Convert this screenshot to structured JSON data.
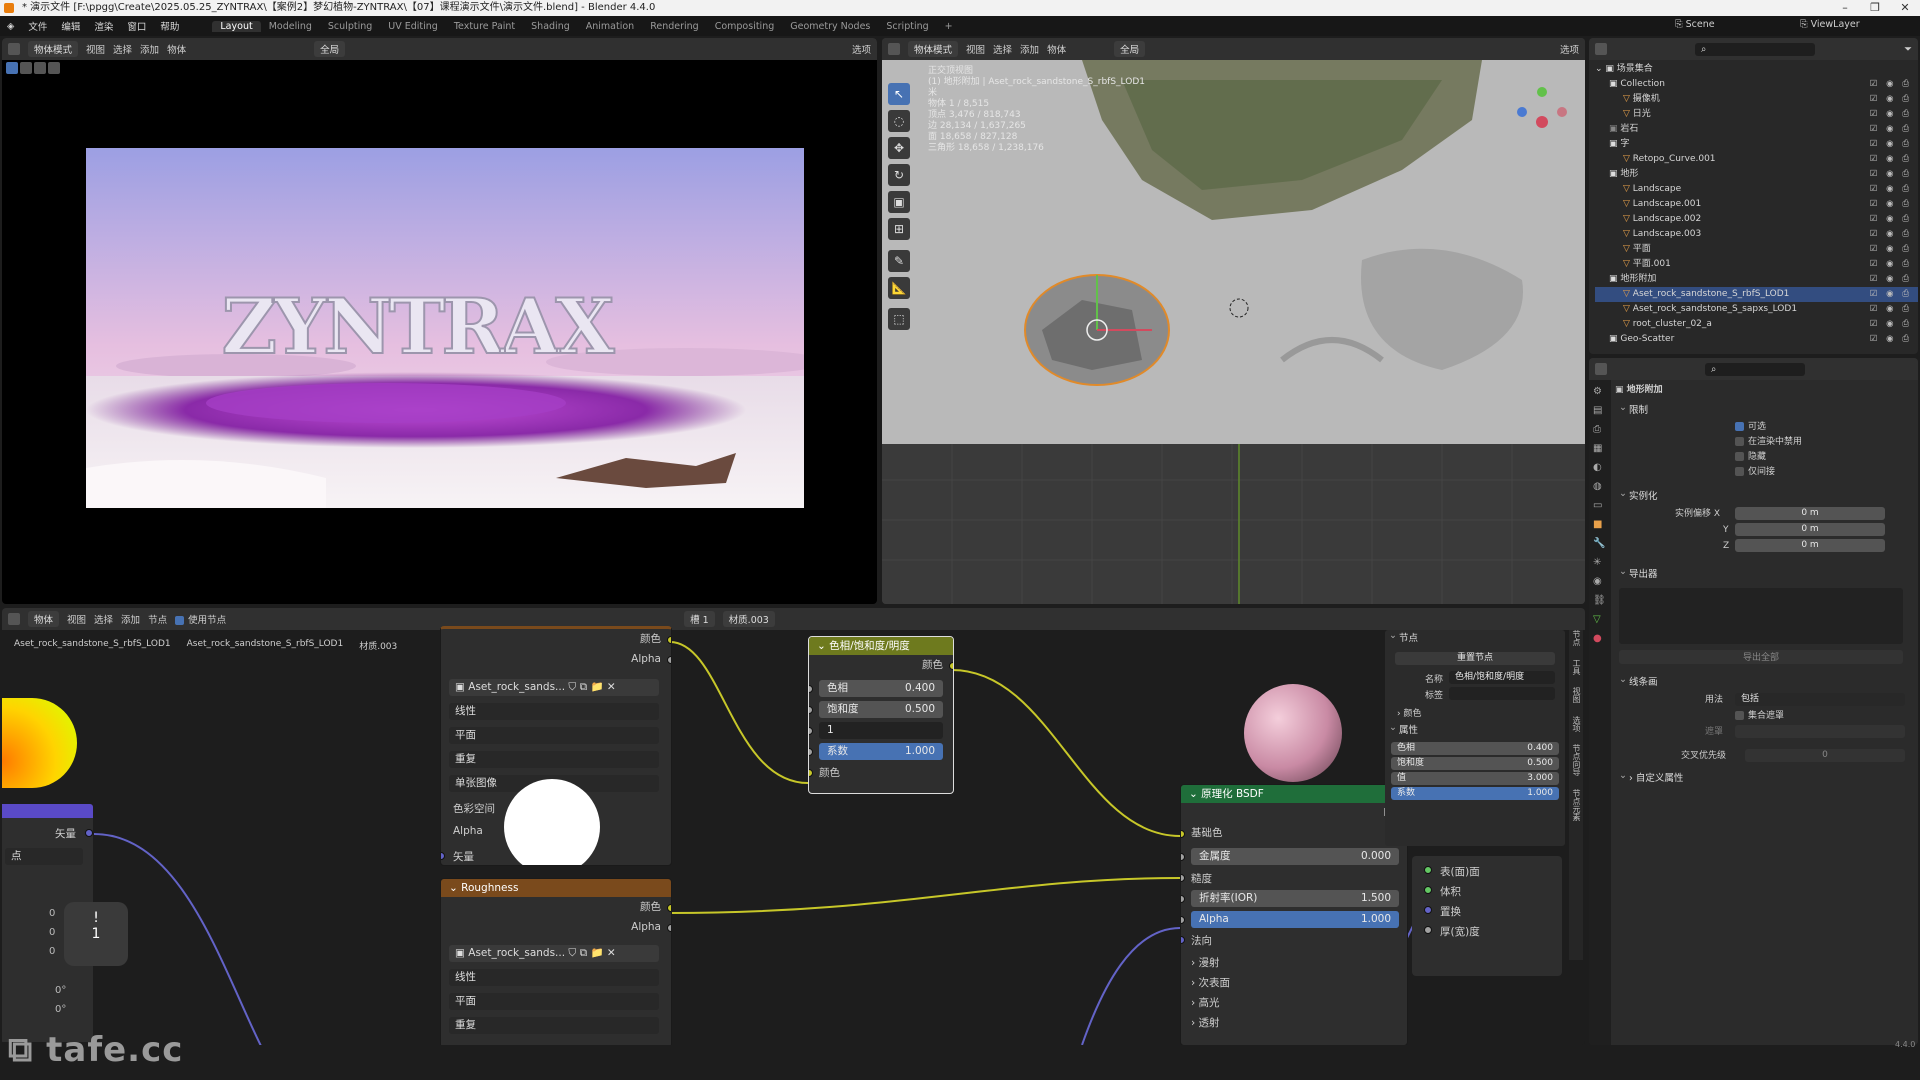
{
  "window": {
    "title": "* 演示文件 [F:\\ppgg\\Create\\2025.05.25_ZYNTRAX\\【案例2】梦幻植物-ZYNTRAX\\【07】课程演示文件\\演示文件.blend] - Blender 4.4.0",
    "min": "–",
    "max": "❐",
    "close": "✕"
  },
  "menu": [
    "文件",
    "编辑",
    "渲染",
    "窗口",
    "帮助"
  ],
  "workspaces": [
    "Layout",
    "Modeling",
    "Sculpting",
    "UV Editing",
    "Texture Paint",
    "Shading",
    "Animation",
    "Rendering",
    "Compositing",
    "Geometry Nodes",
    "Scripting",
    "+"
  ],
  "top_right": {
    "scene": "Scene",
    "viewlayer": "ViewLayer"
  },
  "left_view": {
    "mode": "物体模式",
    "menus": [
      "视图",
      "选择",
      "添加",
      "物体"
    ],
    "global": "全局",
    "options": "选项",
    "logo_text": "ZYNTRAX"
  },
  "view3d": {
    "mode": "物体模式",
    "menus": [
      "视图",
      "选择",
      "添加",
      "物体"
    ],
    "global": "全局",
    "options": "选项",
    "overlay": [
      "正交顶视图",
      "(1) 地形附加 | Aset_rock_sandstone_S_rbfS_LOD1",
      "米",
      "物体   1 / 8,515",
      "顶点   3,476 / 818,743",
      "边   28,134 / 1,637,265",
      "面   18,658 / 827,128",
      "三角形   18,658 / 1,238,176"
    ],
    "tools": [
      "↖",
      "◌",
      "✥",
      "↻",
      "▣",
      "⊞",
      "✎",
      "📐",
      "⬚"
    ]
  },
  "node_editor": {
    "header": {
      "mode": "物体",
      "menus": [
        "视图",
        "选择",
        "添加",
        "节点"
      ],
      "use_nodes": "使用节点",
      "slot": "槽 1",
      "material": "材质.003"
    },
    "breadcrumb": [
      "Aset_rock_sandstone_S_rbfS_LOD1",
      "Aset_rock_sandstone_S_rbfS_LOD1",
      "材质.003"
    ],
    "left_partial": {
      "vector_label": "矢量",
      "dropdown": "点",
      "zeros": [
        "0",
        "0",
        "0",
        "0°",
        "0°"
      ],
      "warn_icon": "!",
      "warn_count": "1"
    },
    "image_node": {
      "out_color": "颜色",
      "out_alpha": "Alpha",
      "image_name": "Aset_rock_sands...",
      "interp": "线性",
      "proj": "平面",
      "ext": "重复",
      "source": "单张图像",
      "colorspace_label": "色彩空间",
      "alpha_label": "Alpha",
      "vector": "矢量"
    },
    "rough_node": {
      "title": "Roughness",
      "out_color": "颜色",
      "out_alpha": "Alpha",
      "image_name": "Aset_rock_sands...",
      "interp": "线性",
      "proj": "平面",
      "ext": "重复"
    },
    "hsv_node": {
      "title": "色相/饱和度/明度",
      "out": "颜色",
      "hue_label": "色相",
      "hue": "0.400",
      "sat_label": "饱和度",
      "sat": "0.500",
      "val_input": "1",
      "fac_label": "系数",
      "fac": "1.000",
      "color_in": "颜色"
    },
    "bsdf_node": {
      "title": "原理化 BSDF",
      "bsdf": "BS",
      "base_color": "基础色",
      "metallic_label": "金属度",
      "metallic": "0.000",
      "roughness": "糙度",
      "ior_label": "折射率(IOR)",
      "ior": "1.500",
      "alpha_label": "Alpha",
      "alpha": "1.000",
      "normal": "法向",
      "sub": [
        "漫射",
        "次表面",
        "高光",
        "透射"
      ]
    },
    "output_node": {
      "rows": [
        "表(面)面",
        "体积",
        "置换",
        "厚(宽)度"
      ]
    },
    "sidebar": {
      "section": "节点",
      "reset": "重置节点",
      "name_label": "名称",
      "name_value": "色相/饱和度/明度",
      "label_label": "标签",
      "color": "颜色",
      "props": "属性",
      "rows": [
        {
          "k": "色相",
          "v": "0.400"
        },
        {
          "k": "饱和度",
          "v": "0.500"
        },
        {
          "k": "值",
          "v": "3.000"
        },
        {
          "k": "系数",
          "v": "1.000"
        }
      ],
      "tabs": [
        "节点",
        "工具",
        "视图",
        "选项",
        "节点向导",
        "节点元素"
      ]
    }
  },
  "outliner": {
    "root": "场景集合",
    "rows": [
      {
        "t": "Collection",
        "d": 1,
        "i": "#ddd"
      },
      {
        "t": "摄像机",
        "d": 2,
        "i": "#e8a04a"
      },
      {
        "t": "日光",
        "d": 2,
        "i": "#e8a04a"
      },
      {
        "t": "岩石",
        "d": 1,
        "i": "#888"
      },
      {
        "t": "字",
        "d": 1,
        "i": "#ddd"
      },
      {
        "t": "Retopo_Curve.001",
        "d": 2,
        "i": "#e8a04a"
      },
      {
        "t": "地形",
        "d": 1,
        "i": "#ddd"
      },
      {
        "t": "Landscape",
        "d": 2,
        "i": "#e8a04a"
      },
      {
        "t": "Landscape.001",
        "d": 2,
        "i": "#e8a04a"
      },
      {
        "t": "Landscape.002",
        "d": 2,
        "i": "#e8a04a"
      },
      {
        "t": "Landscape.003",
        "d": 2,
        "i": "#e8a04a"
      },
      {
        "t": "平面",
        "d": 2,
        "i": "#e8a04a"
      },
      {
        "t": "平面.001",
        "d": 2,
        "i": "#e8a04a"
      },
      {
        "t": "地形附加",
        "d": 1,
        "i": "#ddd"
      },
      {
        "t": "Aset_rock_sandstone_S_rbfS_LOD1",
        "d": 2,
        "i": "#e8a04a",
        "sel": true
      },
      {
        "t": "Aset_rock_sandstone_S_sapxs_LOD1",
        "d": 2,
        "i": "#e8a04a"
      },
      {
        "t": "root_cluster_02_a",
        "d": 2,
        "i": "#e8a04a"
      },
      {
        "t": "Geo-Scatter",
        "d": 1,
        "i": "#ddd"
      }
    ]
  },
  "properties": {
    "title": "地形附加",
    "restrict": "限制",
    "chk": [
      {
        "l": "可选",
        "on": true
      },
      {
        "l": "在渲染中禁用",
        "on": false
      },
      {
        "l": "隐藏",
        "on": false
      },
      {
        "l": "仅间接",
        "on": false
      }
    ],
    "instancing": "实例化",
    "offset_label": "实例偏移 X",
    "y": "Y",
    "z": "Z",
    "offset_val": "0 m",
    "exporters": "导出器",
    "export_all": "导出全部",
    "lineart": "线条画",
    "usage_label": "用法",
    "usage_val": "包括",
    "intersect": "集合遮罩",
    "exclusion": "遮罩",
    "priority": "交叉优先级",
    "priority_val": "0",
    "custom": "自定义属性"
  },
  "status": {
    "version": "4.4.0"
  },
  "watermark": "tafe.cc"
}
